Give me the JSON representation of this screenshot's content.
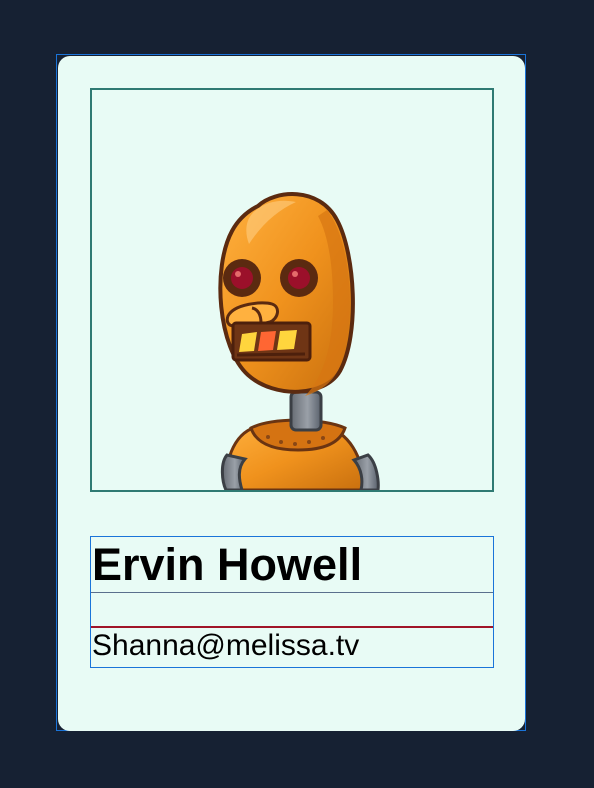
{
  "profile": {
    "name": "Ervin Howell",
    "email": "Shanna@melissa.tv",
    "avatar_icon": "robot-avatar-icon"
  },
  "colors": {
    "page_background": "#162133",
    "card_background": "#e8fbf5",
    "card_border": "#1a74d9",
    "avatar_frame": "#2f7a73",
    "separator": "#a01428"
  }
}
